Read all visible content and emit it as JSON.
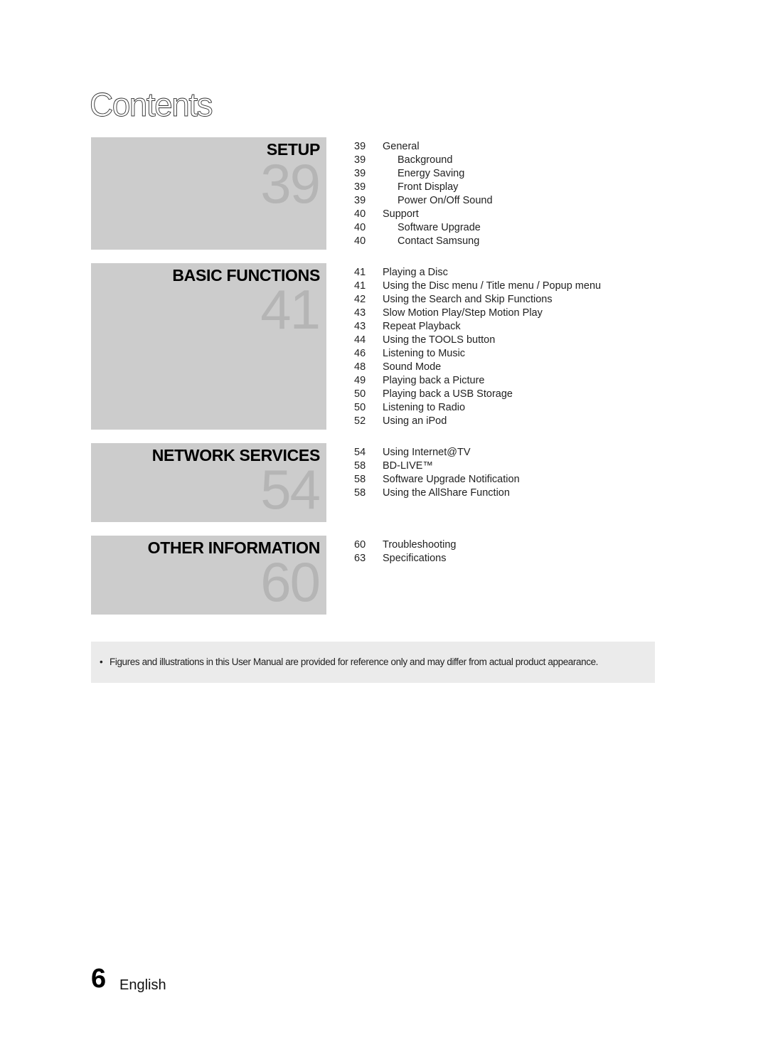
{
  "page_title": "Contents",
  "sections": [
    {
      "name": "SETUP",
      "page": "39",
      "entries": [
        {
          "page": "39",
          "label": "General",
          "sub": false
        },
        {
          "page": "39",
          "label": "Background",
          "sub": true
        },
        {
          "page": "39",
          "label": "Energy Saving",
          "sub": true
        },
        {
          "page": "39",
          "label": "Front Display",
          "sub": true
        },
        {
          "page": "39",
          "label": "Power On/Off Sound",
          "sub": true
        },
        {
          "page": "40",
          "label": "Support",
          "sub": false
        },
        {
          "page": "40",
          "label": "Software Upgrade",
          "sub": true
        },
        {
          "page": "40",
          "label": "Contact Samsung",
          "sub": true
        }
      ]
    },
    {
      "name": "BASIC FUNCTIONS",
      "page": "41",
      "entries": [
        {
          "page": "41",
          "label": "Playing a Disc",
          "sub": false
        },
        {
          "page": "41",
          "label": "Using the Disc menu / Title menu / Popup menu",
          "sub": false
        },
        {
          "page": "42",
          "label": "Using the Search and Skip Functions",
          "sub": false
        },
        {
          "page": "43",
          "label": "Slow Motion Play/Step Motion Play",
          "sub": false
        },
        {
          "page": "43",
          "label": "Repeat Playback",
          "sub": false
        },
        {
          "page": "44",
          "label": "Using the TOOLS button",
          "sub": false
        },
        {
          "page": "46",
          "label": "Listening to Music",
          "sub": false
        },
        {
          "page": "48",
          "label": "Sound Mode",
          "sub": false
        },
        {
          "page": "49",
          "label": "Playing back a Picture",
          "sub": false
        },
        {
          "page": "50",
          "label": "Playing back a USB Storage",
          "sub": false
        },
        {
          "page": "50",
          "label": "Listening to Radio",
          "sub": false
        },
        {
          "page": "52",
          "label": "Using an iPod",
          "sub": false
        }
      ]
    },
    {
      "name": "NETWORK SERVICES",
      "page": "54",
      "entries": [
        {
          "page": "54",
          "label": "Using Internet@TV",
          "sub": false
        },
        {
          "page": "58",
          "label": "BD-LIVE™",
          "sub": false
        },
        {
          "page": "58",
          "label": "Software Upgrade Notification",
          "sub": false
        },
        {
          "page": "58",
          "label": "Using the AllShare Function",
          "sub": false
        }
      ]
    },
    {
      "name": "OTHER INFORMATION",
      "page": "60",
      "entries": [
        {
          "page": "60",
          "label": "Troubleshooting",
          "sub": false
        },
        {
          "page": "63",
          "label": "Specifications",
          "sub": false
        }
      ]
    }
  ],
  "note": {
    "bullet": "•",
    "text": "Figures and illustrations in this User Manual are provided for reference only and may differ from actual product appearance."
  },
  "footer": {
    "page_number": "6",
    "language": "English"
  }
}
